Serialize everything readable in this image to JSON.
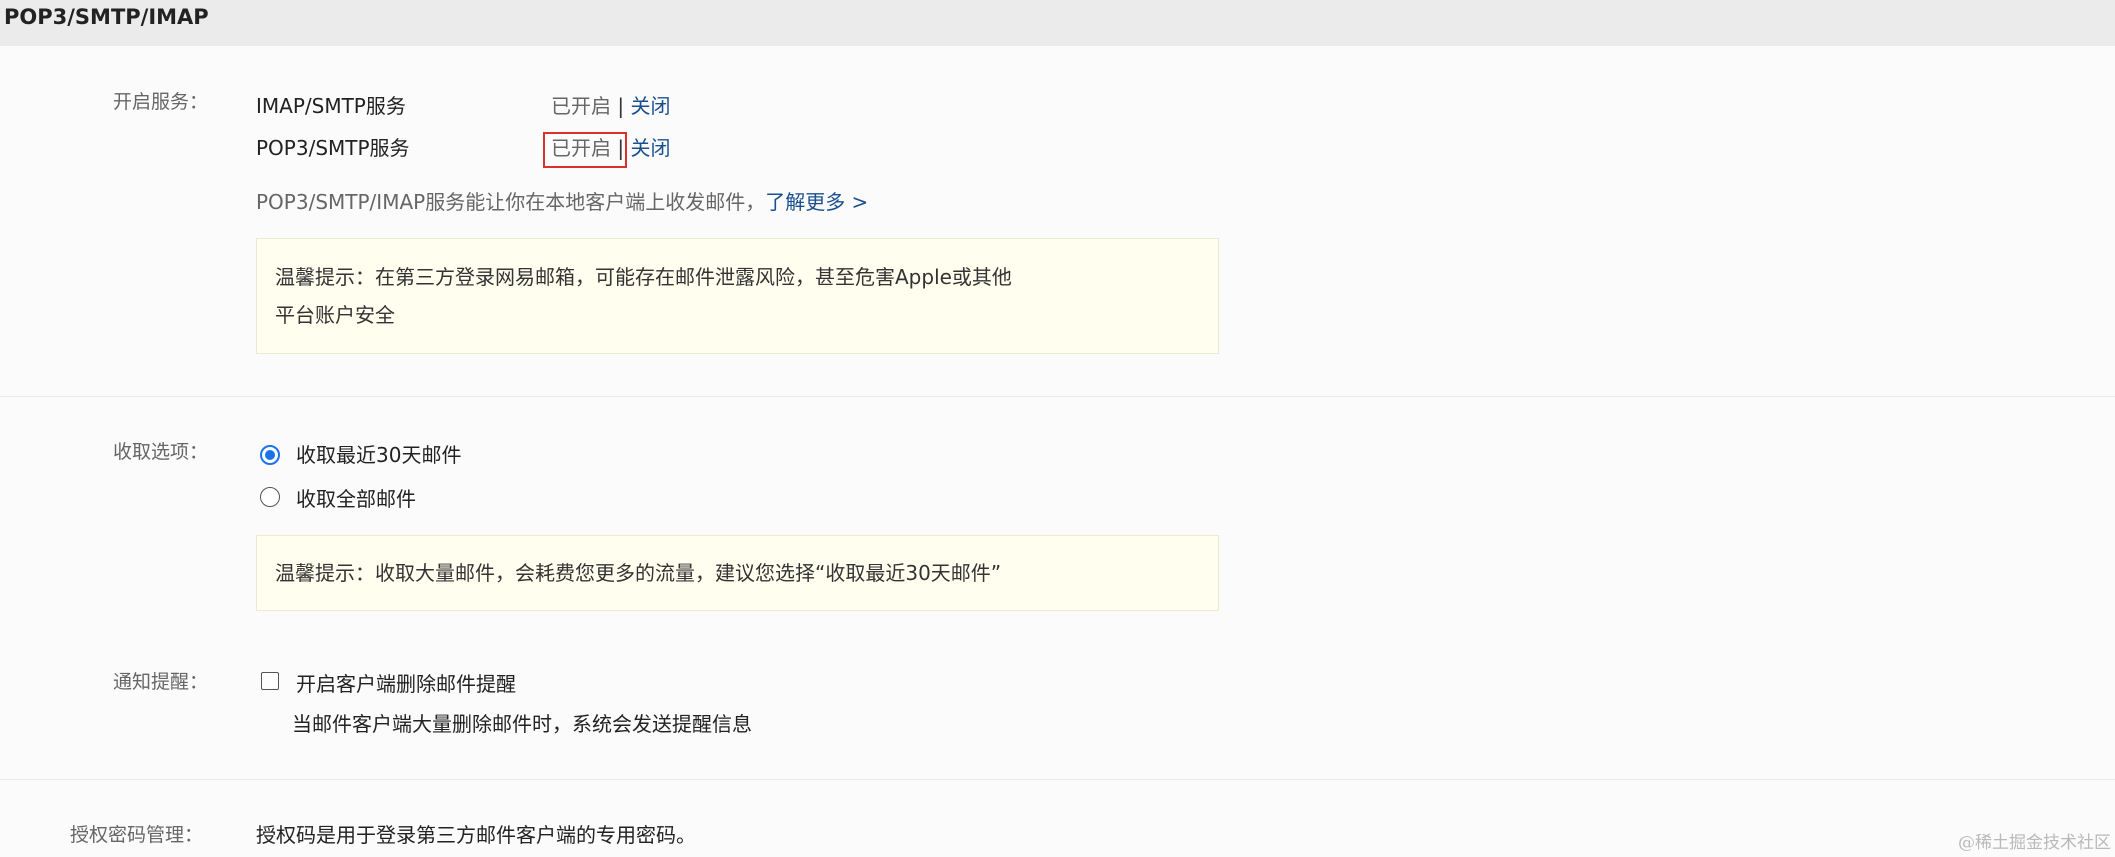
{
  "header": {
    "title": "POP3/SMTP/IMAP"
  },
  "services": {
    "label": "开启服务：",
    "items": [
      {
        "name": "IMAP/SMTP服务",
        "status": "已开启",
        "separator": "|",
        "action": "关闭"
      },
      {
        "name": "POP3/SMTP服务",
        "status": "已开启",
        "separator": "|",
        "action": "关闭"
      }
    ],
    "description": "POP3/SMTP/IMAP服务能让你在本地客户端上收发邮件，",
    "learn_more": "了解更多 >",
    "tip_line1": "温馨提示：在第三方登录网易邮箱，可能存在邮件泄露风险，甚至危害Apple或其他",
    "tip_line2": "平台账户安全"
  },
  "receive": {
    "label": "收取选项：",
    "options": [
      {
        "label": "收取最近30天邮件",
        "selected": true
      },
      {
        "label": "收取全部邮件",
        "selected": false
      }
    ],
    "tip": "温馨提示：收取大量邮件，会耗费您更多的流量，建议您选择“收取最近30天邮件”"
  },
  "notify": {
    "label": "通知提醒：",
    "checkbox_label": "开启客户端删除邮件提醒",
    "checked": false,
    "description": "当邮件客户端大量删除邮件时，系统会发送提醒信息"
  },
  "auth": {
    "label": "授权密码管理：",
    "description": "授权码是用于登录第三方邮件客户端的专用密码。"
  },
  "watermark": "@稀土掘金技术社区",
  "colors": {
    "link": "#1a4f8f",
    "highlight": "#d9312b",
    "radio_accent": "#1a73e8",
    "tip_bg": "#fffeef"
  }
}
